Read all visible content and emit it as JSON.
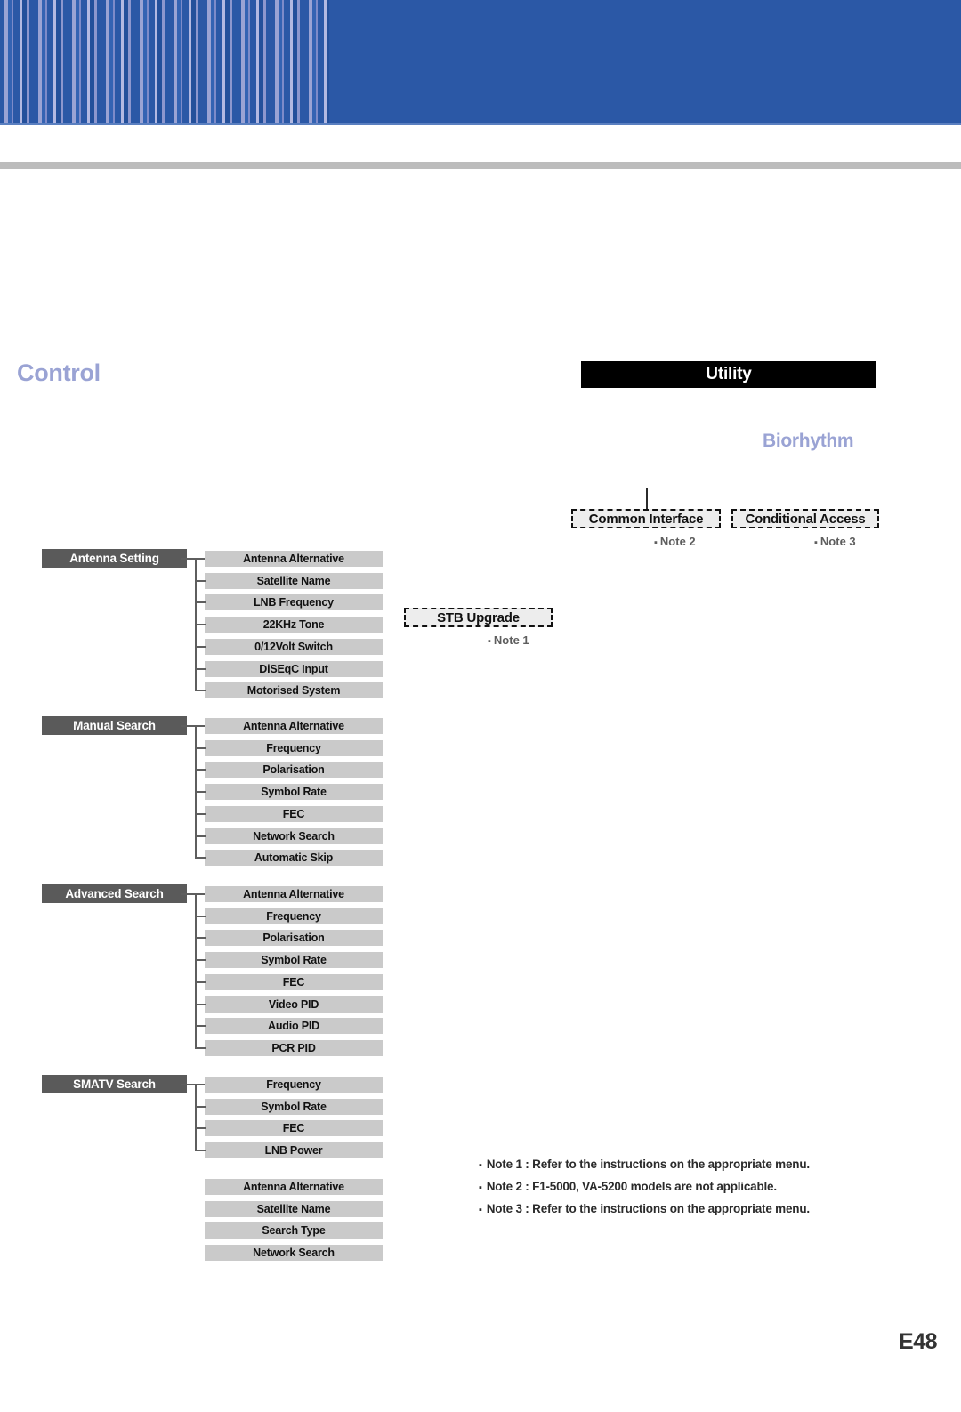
{
  "page": {
    "number": "E48"
  },
  "left_column": {
    "title": "Control",
    "groups": [
      {
        "parent": "Antenna Setting",
        "children": [
          "Antenna Alternative",
          "Satellite Name",
          "LNB Frequency",
          "22KHz Tone",
          "0/12Volt Switch",
          "DiSEqC Input",
          "Motorised System"
        ]
      },
      {
        "parent": "Manual Search",
        "children": [
          "Antenna Alternative",
          "Frequency",
          "Polarisation",
          "Symbol Rate",
          "FEC",
          "Network Search",
          "Automatic Skip"
        ]
      },
      {
        "parent": "Advanced Search",
        "children": [
          "Antenna Alternative",
          "Frequency",
          "Polarisation",
          "Symbol Rate",
          "FEC",
          "Video PID",
          "Audio PID",
          "PCR PID"
        ]
      },
      {
        "parent": "SMATV Search",
        "children": [
          "Frequency",
          "Symbol Rate",
          "FEC",
          "LNB Power"
        ]
      },
      {
        "parent": "",
        "children": [
          "Antenna Alternative",
          "Satellite Name",
          "Search Type",
          "Network Search"
        ]
      }
    ]
  },
  "right_column": {
    "header": "Utility",
    "subtitle": "Biorhythm",
    "dashed_boxes": {
      "common_interface": "Common Interface",
      "conditional_access": "Conditional Access",
      "stb_upgrade": "STB Upgrade"
    },
    "captions": {
      "note1": "Note 1",
      "note2": "Note 2",
      "note3": "Note 3"
    }
  },
  "notes": [
    "Note 1 : Refer to the instructions on the appropriate menu.",
    "Note 2 : F1-5000, VA-5200 models are not applicable.",
    "Note 3 : Refer to the instructions on the appropriate menu."
  ],
  "colors": {
    "banner_blue": "#2b58a6",
    "stripe_light": "#9aa3d4",
    "title_periwinkle": "#9aa3d4",
    "parent_box": "#5a5a5a",
    "child_box": "#cacaca",
    "rule_gray": "#bcbcbc",
    "header_black": "#000000"
  }
}
